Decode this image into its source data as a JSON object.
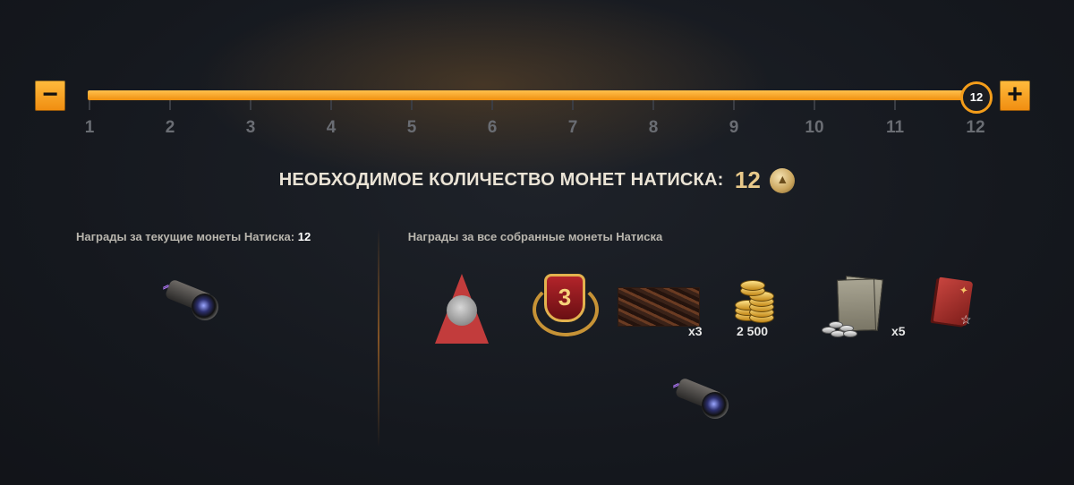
{
  "slider": {
    "min_label": "−",
    "max_label": "+",
    "current_value": "12",
    "progress": 1.0,
    "ticks": [
      "1",
      "2",
      "3",
      "4",
      "5",
      "6",
      "7",
      "8",
      "9",
      "10",
      "11",
      "12"
    ]
  },
  "required": {
    "label": "НЕОБХОДИМОЕ КОЛИЧЕСТВО МОНЕТ НАТИСКА:",
    "value": "12"
  },
  "left_panel": {
    "title": "Награды за текущие монеты Натиска:",
    "title_value": "12"
  },
  "right_panel": {
    "title": "Награды за все собранные монеты Натиска",
    "counts": {
      "style": "x3",
      "gold": "2 500",
      "orders": "x5"
    }
  },
  "colors": {
    "accent": "#f49d1a",
    "background": "#15181e",
    "coin": "#e8c98a"
  },
  "icons": {
    "rank_number": "3"
  }
}
